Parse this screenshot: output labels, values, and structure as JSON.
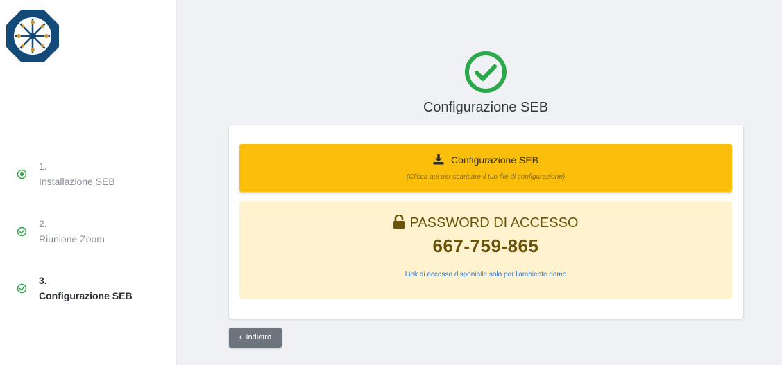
{
  "sidebar": {
    "logo_icon": "organization-logo-icon",
    "steps": [
      {
        "number": "1.",
        "label": "Installazione SEB",
        "state": "current",
        "icon": "radio-dot-icon"
      },
      {
        "number": "2.",
        "label": "Riunione Zoom",
        "state": "done",
        "icon": "check-circle-icon"
      },
      {
        "number": "3.",
        "label": "Configurazione SEB",
        "state": "active",
        "icon": "check-circle-icon"
      }
    ]
  },
  "main": {
    "status_icon": "success-check-icon",
    "title": "Configurazione SEB",
    "download": {
      "icon": "download-icon",
      "label": "Configurazione SEB",
      "hint": "(Clicca qui per scaricare il tuo file di configurazione)"
    },
    "password": {
      "icon": "unlock-icon",
      "heading": "PASSWORD DI ACCESSO",
      "code": "667-759-865",
      "link": "Link di accesso disponibile solo per l'ambiente demo"
    },
    "back_button": "Indietro"
  },
  "colors": {
    "accent_green": "#2aa84a",
    "download_bg": "#fbbf0b",
    "password_bg": "#fff3cf",
    "password_text": "#6b5408",
    "link": "#3576d6",
    "back_button_bg": "#6c747d"
  }
}
